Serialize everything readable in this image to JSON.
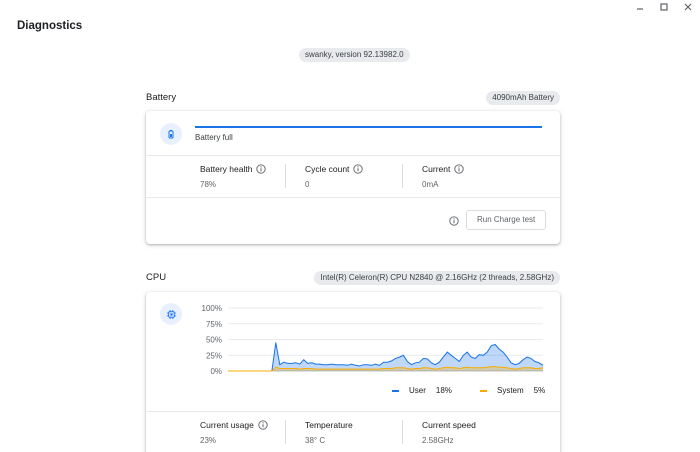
{
  "app": {
    "title": "Diagnostics"
  },
  "version": "swanky, version 92.13982.0",
  "battery": {
    "section_label": "Battery",
    "chip": "4090mAh Battery",
    "status": "Battery full",
    "charge_fraction": 1.0,
    "metrics": [
      {
        "label": "Battery health",
        "value": "78%"
      },
      {
        "label": "Cycle count",
        "value": "0"
      },
      {
        "label": "Current",
        "value": "0mA"
      }
    ],
    "run_button": "Run Charge test"
  },
  "cpu": {
    "section_label": "CPU",
    "chip": "Intel(R) Celeron(R) CPU N2840 @ 2.16GHz (2 threads, 2.58GHz)",
    "legend": [
      {
        "name": "User",
        "value": "18%",
        "color": "#1a73e8"
      },
      {
        "name": "System",
        "value": "5%",
        "color": "#f9ab00"
      }
    ],
    "metrics": [
      {
        "label": "Current usage",
        "value": "23%"
      },
      {
        "label": "Temperature",
        "value": "38° C"
      },
      {
        "label": "Current speed",
        "value": "2.58GHz"
      }
    ]
  },
  "chart_data": {
    "type": "area",
    "y_ticks": [
      "100%",
      "75%",
      "50%",
      "25%",
      "0%"
    ],
    "ylim": [
      0,
      100
    ],
    "x": [
      0,
      1,
      2,
      3,
      4,
      5,
      6,
      7,
      8,
      9,
      10,
      11,
      12,
      13,
      14,
      15,
      16,
      17,
      18,
      19,
      20,
      21,
      22,
      23,
      24,
      25,
      26,
      27,
      28,
      29,
      30,
      31,
      32,
      33,
      34,
      35,
      36,
      37,
      38,
      39,
      40,
      41,
      42,
      43,
      44,
      45,
      46,
      47,
      48,
      49,
      50,
      51,
      52,
      53,
      54,
      55,
      56,
      57,
      58,
      59,
      60,
      61,
      62,
      63,
      64,
      65,
      66,
      67,
      68,
      69,
      70,
      71,
      72,
      73,
      74,
      75,
      76,
      77,
      78,
      79
    ],
    "series": [
      {
        "name": "User",
        "color": "#1a73e8",
        "values": [
          0,
          0,
          0,
          0,
          0,
          0,
          0,
          0,
          0,
          0,
          0,
          0,
          45,
          10,
          14,
          12,
          12,
          13,
          11,
          18,
          12,
          13,
          11,
          11,
          10,
          10,
          11,
          10,
          10,
          10,
          9,
          11,
          9,
          8,
          10,
          10,
          9,
          11,
          9,
          14,
          14,
          16,
          20,
          22,
          25,
          15,
          10,
          13,
          14,
          20,
          19,
          13,
          10,
          14,
          22,
          30,
          25,
          20,
          15,
          25,
          30,
          22,
          20,
          26,
          25,
          30,
          40,
          42,
          35,
          30,
          22,
          13,
          10,
          12,
          18,
          22,
          20,
          15,
          13,
          9
        ]
      },
      {
        "name": "System",
        "color": "#f9ab00",
        "values": [
          0,
          0,
          0,
          0,
          0,
          0,
          0,
          0,
          0,
          0,
          0,
          0,
          6,
          4,
          4,
          4,
          4,
          4,
          3,
          4,
          4,
          4,
          3,
          3,
          3,
          3,
          3,
          3,
          3,
          3,
          3,
          3,
          3,
          3,
          3,
          3,
          3,
          3,
          3,
          4,
          4,
          4,
          5,
          5,
          5,
          4,
          3,
          4,
          4,
          5,
          5,
          4,
          3,
          4,
          5,
          6,
          5,
          5,
          4,
          5,
          6,
          5,
          5,
          5,
          5,
          6,
          7,
          7,
          6,
          6,
          5,
          4,
          3,
          4,
          5,
          5,
          5,
          4,
          4,
          5
        ]
      }
    ]
  }
}
